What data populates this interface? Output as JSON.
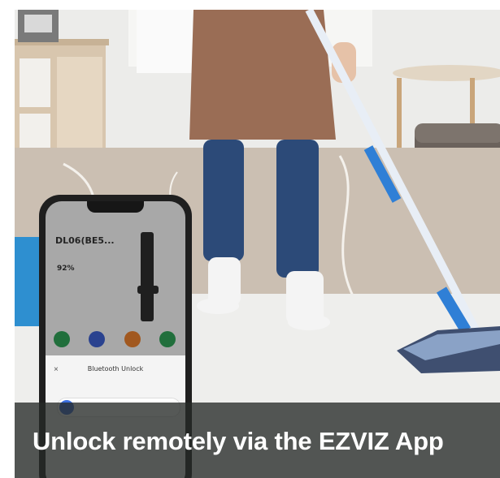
{
  "caption": {
    "text": "Unlock remotely via the EZVIZ App"
  },
  "phone": {
    "device_name": "DL06(BE5...",
    "battery": "92%",
    "sheet_title": "Bluetooth Unlock",
    "sheet_close": "×"
  },
  "colors": {
    "caption_bg": "#262a28",
    "accent_blue": "#3b6fe0",
    "apron": "#9a6d55",
    "jeans": "#2c4a78"
  }
}
